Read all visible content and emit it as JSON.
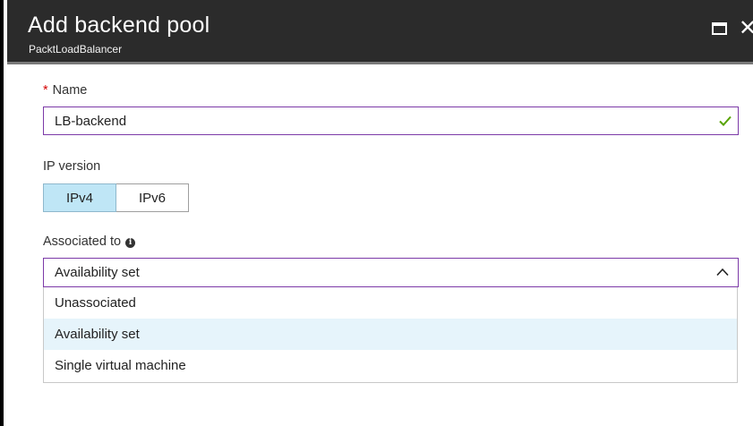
{
  "blade": {
    "title": "Add backend pool",
    "subtitle": "PacktLoadBalancer",
    "close_glyph": "✕"
  },
  "form": {
    "name": {
      "required_mark": "*",
      "label": "Name",
      "value": "LB-backend",
      "valid": true
    },
    "ip_version": {
      "label": "IP version",
      "options": [
        "IPv4",
        "IPv6"
      ],
      "selected": "IPv4"
    },
    "associated_to": {
      "label": "Associated to",
      "info_glyph": "i",
      "selected": "Availability set",
      "options": [
        "Unassociated",
        "Availability set",
        "Single virtual machine"
      ],
      "highlighted": "Availability set"
    }
  },
  "colors": {
    "header_bg": "#2b2b2b",
    "input_border": "#7c3aa8",
    "valid_check": "#57a300",
    "required_star": "#d40000",
    "toggle_selected": "#bfe6f6",
    "option_highlight": "#e6f4fb"
  },
  "icons": {
    "maximize": "maximize-icon",
    "close": "close-icon",
    "check": "checkmark-icon",
    "info": "info-icon",
    "chevron": "chevron-up-icon"
  }
}
